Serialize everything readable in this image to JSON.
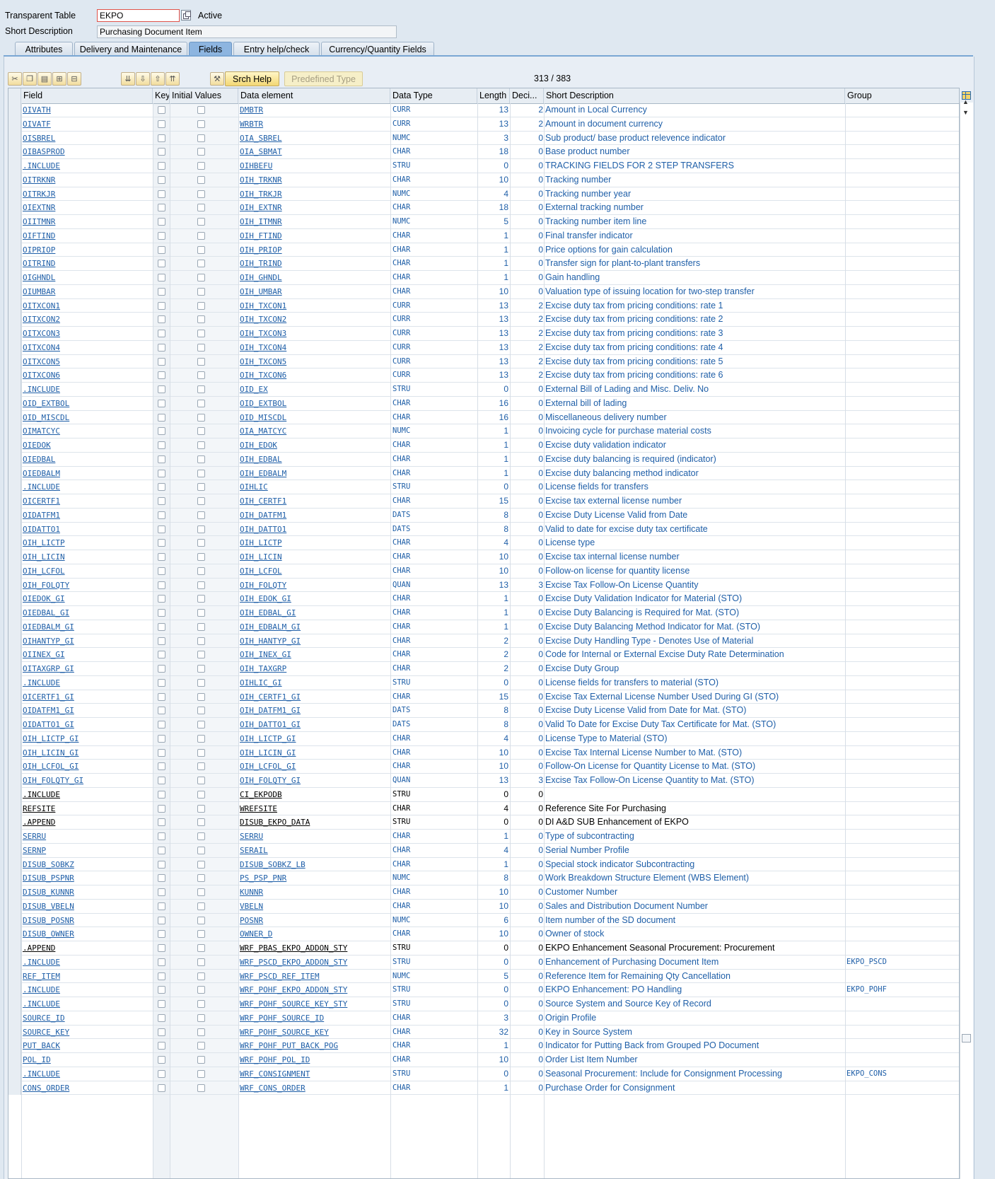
{
  "header": {
    "table_label": "Transparent Table",
    "table_value": "EKPO",
    "status": "Active",
    "desc_label": "Short Description",
    "desc_value": "Purchasing Document Item"
  },
  "tabs": [
    "Attributes",
    "Delivery and Maintenance",
    "Fields",
    "Entry help/check",
    "Currency/Quantity Fields"
  ],
  "active_tab": "Fields",
  "toolbar": {
    "srch_help": "Srch Help",
    "predefined_type": "Predefined Type",
    "counter": "313  /  383"
  },
  "columns": {
    "field": "Field",
    "key": "Key",
    "initial": "Initial Values",
    "data_element": "Data element",
    "data_type": "Data Type",
    "length": "Length",
    "decimals": "Deci...",
    "short_desc": "Short Description",
    "group": "Group"
  },
  "rows": [
    {
      "field": "OIVATH",
      "de": "DMBTR",
      "dt": "CURR",
      "len": "13",
      "dec": "2",
      "desc": "Amount in Local Currency",
      "grp": ""
    },
    {
      "field": "OIVATF",
      "de": "WRBTR",
      "dt": "CURR",
      "len": "13",
      "dec": "2",
      "desc": "Amount in document currency",
      "grp": ""
    },
    {
      "field": "OISBREL",
      "de": "OIA_SBREL",
      "dt": "NUMC",
      "len": "3",
      "dec": "0",
      "desc": "Sub product/ base product relevence indicator",
      "grp": ""
    },
    {
      "field": "OIBASPROD",
      "de": "OIA_SBMAT",
      "dt": "CHAR",
      "len": "18",
      "dec": "0",
      "desc": "Base product number",
      "grp": ""
    },
    {
      "field": ".INCLUDE",
      "de": "OIHBEFU",
      "dt": "STRU",
      "len": "0",
      "dec": "0",
      "desc": "TRACKING FIELDS FOR 2 STEP TRANSFERS",
      "grp": ""
    },
    {
      "field": "OITRKNR",
      "de": "OIH_TRKNR",
      "dt": "CHAR",
      "len": "10",
      "dec": "0",
      "desc": "Tracking number",
      "grp": ""
    },
    {
      "field": "OITRKJR",
      "de": "OIH_TRKJR",
      "dt": "NUMC",
      "len": "4",
      "dec": "0",
      "desc": "Tracking number year",
      "grp": ""
    },
    {
      "field": "OIEXTNR",
      "de": "OIH_EXTNR",
      "dt": "CHAR",
      "len": "18",
      "dec": "0",
      "desc": "External tracking number",
      "grp": ""
    },
    {
      "field": "OIITMNR",
      "de": "OIH_ITMNR",
      "dt": "NUMC",
      "len": "5",
      "dec": "0",
      "desc": "Tracking number item line",
      "grp": ""
    },
    {
      "field": "OIFTIND",
      "de": "OIH_FTIND",
      "dt": "CHAR",
      "len": "1",
      "dec": "0",
      "desc": "Final transfer indicator",
      "grp": ""
    },
    {
      "field": "OIPRIOP",
      "de": "OIH_PRIOP",
      "dt": "CHAR",
      "len": "1",
      "dec": "0",
      "desc": "Price options for gain calculation",
      "grp": ""
    },
    {
      "field": "OITRIND",
      "de": "OIH_TRIND",
      "dt": "CHAR",
      "len": "1",
      "dec": "0",
      "desc": "Transfer sign for plant-to-plant transfers",
      "grp": ""
    },
    {
      "field": "OIGHNDL",
      "de": "OIH_GHNDL",
      "dt": "CHAR",
      "len": "1",
      "dec": "0",
      "desc": "Gain handling",
      "grp": ""
    },
    {
      "field": "OIUMBAR",
      "de": "OIH_UMBAR",
      "dt": "CHAR",
      "len": "10",
      "dec": "0",
      "desc": "Valuation type of issuing location for two-step transfer",
      "grp": ""
    },
    {
      "field": "OITXCON1",
      "de": "OIH_TXCON1",
      "dt": "CURR",
      "len": "13",
      "dec": "2",
      "desc": "Excise duty tax from pricing conditions: rate 1",
      "grp": ""
    },
    {
      "field": "OITXCON2",
      "de": "OIH_TXCON2",
      "dt": "CURR",
      "len": "13",
      "dec": "2",
      "desc": "Excise duty tax from pricing conditions: rate 2",
      "grp": ""
    },
    {
      "field": "OITXCON3",
      "de": "OIH_TXCON3",
      "dt": "CURR",
      "len": "13",
      "dec": "2",
      "desc": "Excise duty tax from pricing conditions: rate 3",
      "grp": ""
    },
    {
      "field": "OITXCON4",
      "de": "OIH_TXCON4",
      "dt": "CURR",
      "len": "13",
      "dec": "2",
      "desc": "Excise duty tax from pricing conditions: rate 4",
      "grp": ""
    },
    {
      "field": "OITXCON5",
      "de": "OIH_TXCON5",
      "dt": "CURR",
      "len": "13",
      "dec": "2",
      "desc": "Excise duty tax from pricing conditions: rate 5",
      "grp": ""
    },
    {
      "field": "OITXCON6",
      "de": "OIH_TXCON6",
      "dt": "CURR",
      "len": "13",
      "dec": "2",
      "desc": "Excise duty tax from pricing conditions: rate 6",
      "grp": ""
    },
    {
      "field": ".INCLUDE",
      "de": "OID_EX",
      "dt": "STRU",
      "len": "0",
      "dec": "0",
      "desc": "External Bill of Lading and Misc. Deliv. No",
      "grp": ""
    },
    {
      "field": "OID_EXTBOL",
      "de": "OID_EXTBOL",
      "dt": "CHAR",
      "len": "16",
      "dec": "0",
      "desc": "External bill of lading",
      "grp": ""
    },
    {
      "field": "OID_MISCDL",
      "de": "OID_MISCDL",
      "dt": "CHAR",
      "len": "16",
      "dec": "0",
      "desc": "Miscellaneous delivery number",
      "grp": ""
    },
    {
      "field": "OIMATCYC",
      "de": "OIA_MATCYC",
      "dt": "NUMC",
      "len": "1",
      "dec": "0",
      "desc": "Invoicing cycle for purchase material costs",
      "grp": ""
    },
    {
      "field": "OIEDOK",
      "de": "OIH_EDOK",
      "dt": "CHAR",
      "len": "1",
      "dec": "0",
      "desc": "Excise duty validation indicator",
      "grp": ""
    },
    {
      "field": "OIEDBAL",
      "de": "OIH_EDBAL",
      "dt": "CHAR",
      "len": "1",
      "dec": "0",
      "desc": "Excise duty balancing is required (indicator)",
      "grp": ""
    },
    {
      "field": "OIEDBALM",
      "de": "OIH_EDBALM",
      "dt": "CHAR",
      "len": "1",
      "dec": "0",
      "desc": "Excise duty balancing method indicator",
      "grp": ""
    },
    {
      "field": ".INCLUDE",
      "de": "OIHLIC",
      "dt": "STRU",
      "len": "0",
      "dec": "0",
      "desc": "License fields for transfers",
      "grp": ""
    },
    {
      "field": "OICERTF1",
      "de": "OIH_CERTF1",
      "dt": "CHAR",
      "len": "15",
      "dec": "0",
      "desc": "Excise tax external license number",
      "grp": ""
    },
    {
      "field": "OIDATFM1",
      "de": "OIH_DATFM1",
      "dt": "DATS",
      "len": "8",
      "dec": "0",
      "desc": "Excise Duty License Valid from Date",
      "grp": ""
    },
    {
      "field": "OIDATTO1",
      "de": "OIH_DATTO1",
      "dt": "DATS",
      "len": "8",
      "dec": "0",
      "desc": "Valid to date for excise duty tax certificate",
      "grp": ""
    },
    {
      "field": "OIH_LICTP",
      "de": "OIH_LICTP",
      "dt": "CHAR",
      "len": "4",
      "dec": "0",
      "desc": "License type",
      "grp": ""
    },
    {
      "field": "OIH_LICIN",
      "de": "OIH_LICIN",
      "dt": "CHAR",
      "len": "10",
      "dec": "0",
      "desc": "Excise tax internal license number",
      "grp": ""
    },
    {
      "field": "OIH_LCFOL",
      "de": "OIH_LCFOL",
      "dt": "CHAR",
      "len": "10",
      "dec": "0",
      "desc": "Follow-on license for quantity license",
      "grp": ""
    },
    {
      "field": "OIH_FOLQTY",
      "de": "OIH_FOLQTY",
      "dt": "QUAN",
      "len": "13",
      "dec": "3",
      "desc": "Excise Tax Follow-On License Quantity",
      "grp": ""
    },
    {
      "field": "OIEDOK_GI",
      "de": "OIH_EDOK_GI",
      "dt": "CHAR",
      "len": "1",
      "dec": "0",
      "desc": "Excise Duty Validation Indicator for Material (STO)",
      "grp": ""
    },
    {
      "field": "OIEDBAL_GI",
      "de": "OIH_EDBAL_GI",
      "dt": "CHAR",
      "len": "1",
      "dec": "0",
      "desc": "Excise Duty Balancing is Required for Mat. (STO)",
      "grp": ""
    },
    {
      "field": "OIEDBALM_GI",
      "de": "OIH_EDBALM_GI",
      "dt": "CHAR",
      "len": "1",
      "dec": "0",
      "desc": "Excise Duty Balancing Method Indicator for Mat.  (STO)",
      "grp": ""
    },
    {
      "field": "OIHANTYP_GI",
      "de": "OIH_HANTYP_GI",
      "dt": "CHAR",
      "len": "2",
      "dec": "0",
      "desc": "Excise Duty Handling Type - Denotes Use of Material",
      "grp": ""
    },
    {
      "field": "OIINEX_GI",
      "de": "OIH_INEX_GI",
      "dt": "CHAR",
      "len": "2",
      "dec": "0",
      "desc": "Code for Internal or External Excise Duty Rate Determination",
      "grp": ""
    },
    {
      "field": "OITAXGRP_GI",
      "de": "OIH_TAXGRP",
      "dt": "CHAR",
      "len": "2",
      "dec": "0",
      "desc": "Excise Duty Group",
      "grp": ""
    },
    {
      "field": ".INCLUDE",
      "de": "OIHLIC_GI",
      "dt": "STRU",
      "len": "0",
      "dec": "0",
      "desc": "License fields for transfers to material (STO)",
      "grp": ""
    },
    {
      "field": "OICERTF1_GI",
      "de": "OIH_CERTF1_GI",
      "dt": "CHAR",
      "len": "15",
      "dec": "0",
      "desc": "Excise Tax External License Number Used During GI (STO)",
      "grp": ""
    },
    {
      "field": "OIDATFM1_GI",
      "de": "OIH_DATFM1_GI",
      "dt": "DATS",
      "len": "8",
      "dec": "0",
      "desc": "Excise Duty License Valid from Date for Mat. (STO)",
      "grp": ""
    },
    {
      "field": "OIDATTO1_GI",
      "de": "OIH_DATTO1_GI",
      "dt": "DATS",
      "len": "8",
      "dec": "0",
      "desc": "Valid To Date for Excise Duty Tax Certificate for Mat. (STO)",
      "grp": ""
    },
    {
      "field": "OIH_LICTP_GI",
      "de": "OIH_LICTP_GI",
      "dt": "CHAR",
      "len": "4",
      "dec": "0",
      "desc": "License Type to Material (STO)",
      "grp": ""
    },
    {
      "field": "OIH_LICIN_GI",
      "de": "OIH_LICIN_GI",
      "dt": "CHAR",
      "len": "10",
      "dec": "0",
      "desc": "Excise Tax Internal License Number to Mat. (STO)",
      "grp": ""
    },
    {
      "field": "OIH_LCFOL_GI",
      "de": "OIH_LCFOL_GI",
      "dt": "CHAR",
      "len": "10",
      "dec": "0",
      "desc": "Follow-On License for Quantity License to Mat. (STO)",
      "grp": ""
    },
    {
      "field": "OIH_FOLQTY_GI",
      "de": "OIH_FOLQTY_GI",
      "dt": "QUAN",
      "len": "13",
      "dec": "3",
      "desc": "Excise Tax Follow-On License Quantity to Mat. (STO)",
      "grp": ""
    },
    {
      "field": ".INCLUDE",
      "de": "CI_EKPODB",
      "dt": "STRU",
      "len": "0",
      "dec": "0",
      "desc": "",
      "grp": "",
      "own": true
    },
    {
      "field": "REFSITE",
      "de": "WREFSITE",
      "dt": "CHAR",
      "len": "4",
      "dec": "0",
      "desc": "Reference Site For Purchasing",
      "grp": "",
      "own": true
    },
    {
      "field": ".APPEND",
      "de": "DISUB_EKPO_DATA",
      "dt": "STRU",
      "len": "0",
      "dec": "0",
      "desc": "DI A&D SUB Enhancement of EKPO",
      "grp": "",
      "own": true
    },
    {
      "field": "SERRU",
      "de": "SERRU",
      "dt": "CHAR",
      "len": "1",
      "dec": "0",
      "desc": "Type of subcontracting",
      "grp": ""
    },
    {
      "field": "SERNP",
      "de": "SERAIL",
      "dt": "CHAR",
      "len": "4",
      "dec": "0",
      "desc": "Serial Number Profile",
      "grp": ""
    },
    {
      "field": "DISUB_SOBKZ",
      "de": "DISUB_SOBKZ_LB",
      "dt": "CHAR",
      "len": "1",
      "dec": "0",
      "desc": "Special stock indicator Subcontracting",
      "grp": ""
    },
    {
      "field": "DISUB_PSPNR",
      "de": "PS_PSP_PNR",
      "dt": "NUMC",
      "len": "8",
      "dec": "0",
      "desc": "Work Breakdown Structure Element (WBS Element)",
      "grp": ""
    },
    {
      "field": "DISUB_KUNNR",
      "de": "KUNNR",
      "dt": "CHAR",
      "len": "10",
      "dec": "0",
      "desc": "Customer Number",
      "grp": ""
    },
    {
      "field": "DISUB_VBELN",
      "de": "VBELN",
      "dt": "CHAR",
      "len": "10",
      "dec": "0",
      "desc": "Sales and Distribution Document Number",
      "grp": ""
    },
    {
      "field": "DISUB_POSNR",
      "de": "POSNR",
      "dt": "NUMC",
      "len": "6",
      "dec": "0",
      "desc": "Item number of the SD document",
      "grp": ""
    },
    {
      "field": "DISUB_OWNER",
      "de": "OWNER_D",
      "dt": "CHAR",
      "len": "10",
      "dec": "0",
      "desc": "Owner of stock",
      "grp": ""
    },
    {
      "field": ".APPEND",
      "de": "WRF_PBAS_EKPO_ADDON_STY",
      "dt": "STRU",
      "len": "0",
      "dec": "0",
      "desc": "EKPO Enhancement Seasonal Procurement: Procurement",
      "grp": "",
      "own": true
    },
    {
      "field": ".INCLUDE",
      "de": "WRF_PSCD_EKPO_ADDON_STY",
      "dt": "STRU",
      "len": "0",
      "dec": "0",
      "desc": "Enhancement of Purchasing Document Item",
      "grp": "EKPO_PSCD"
    },
    {
      "field": "REF_ITEM",
      "de": "WRF_PSCD_REF_ITEM",
      "dt": "NUMC",
      "len": "5",
      "dec": "0",
      "desc": "Reference Item for Remaining Qty Cancellation",
      "grp": ""
    },
    {
      "field": ".INCLUDE",
      "de": "WRF_POHF_EKPO_ADDON_STY",
      "dt": "STRU",
      "len": "0",
      "dec": "0",
      "desc": "EKPO Enhancement: PO Handling",
      "grp": "EKPO_POHF"
    },
    {
      "field": ".INCLUDE",
      "de": "WRF_POHF_SOURCE_KEY_STY",
      "dt": "STRU",
      "len": "0",
      "dec": "0",
      "desc": "Source System and Source Key of Record",
      "grp": ""
    },
    {
      "field": "SOURCE_ID",
      "de": "WRF_POHF_SOURCE_ID",
      "dt": "CHAR",
      "len": "3",
      "dec": "0",
      "desc": "Origin Profile",
      "grp": ""
    },
    {
      "field": "SOURCE_KEY",
      "de": "WRF_POHF_SOURCE_KEY",
      "dt": "CHAR",
      "len": "32",
      "dec": "0",
      "desc": "Key in Source System",
      "grp": ""
    },
    {
      "field": "PUT_BACK",
      "de": "WRF_POHF_PUT_BACK_POG",
      "dt": "CHAR",
      "len": "1",
      "dec": "0",
      "desc": "Indicator for Putting Back from Grouped PO Document",
      "grp": ""
    },
    {
      "field": "POL_ID",
      "de": "WRF_POHF_POL_ID",
      "dt": "CHAR",
      "len": "10",
      "dec": "0",
      "desc": "Order List Item Number",
      "grp": ""
    },
    {
      "field": ".INCLUDE",
      "de": "WRF_CONSIGNMENT",
      "dt": "STRU",
      "len": "0",
      "dec": "0",
      "desc": "Seasonal Procurement: Include for Consignment Processing",
      "grp": "EKPO_CONS"
    },
    {
      "field": "CONS_ORDER",
      "de": "WRF_CONS_ORDER",
      "dt": "CHAR",
      "len": "1",
      "dec": "0",
      "desc": "Purchase Order for Consignment",
      "grp": ""
    }
  ]
}
